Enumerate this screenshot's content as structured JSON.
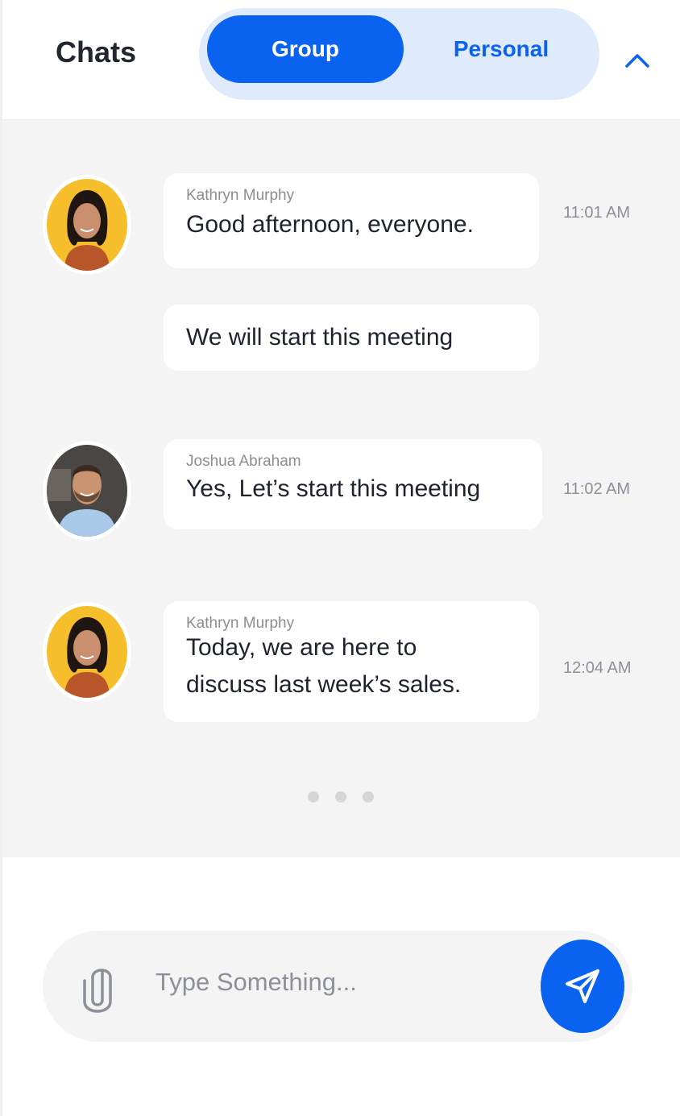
{
  "header": {
    "title": "Chats",
    "tabs": [
      {
        "label": "Group",
        "active": true
      },
      {
        "label": "Personal",
        "active": false
      }
    ],
    "collapse_icon": "chevron-up-icon"
  },
  "messages": [
    {
      "sender": "Kathryn Murphy",
      "text": "Good afternoon, everyone.",
      "time": "11:01 AM",
      "avatar": "kathryn-murphy-avatar"
    },
    {
      "sender": "",
      "text": "We will start this meeting",
      "time": ""
    },
    {
      "sender": "Joshua Abraham",
      "text": "Yes, Let’s start this meeting",
      "time": "11:02 AM",
      "avatar": "joshua-abraham-avatar"
    },
    {
      "sender": "Kathryn Murphy",
      "text_line1": "Today, we are here to",
      "text_line2": "discuss last week’s sales.",
      "time": "12:04 AM",
      "avatar": "kathryn-murphy-avatar"
    }
  ],
  "typing_indicator": {
    "dots": 3
  },
  "composer": {
    "placeholder": "Type Something...",
    "value": "",
    "attach_icon": "paperclip-icon",
    "send_icon": "send-icon"
  },
  "colors": {
    "accent": "#0a63f0",
    "segment_bg": "#dfebfc",
    "chat_bg": "#f4f4f4",
    "bubble_bg": "#ffffff",
    "avatar_kathryn_bg": "#f7be2c"
  }
}
